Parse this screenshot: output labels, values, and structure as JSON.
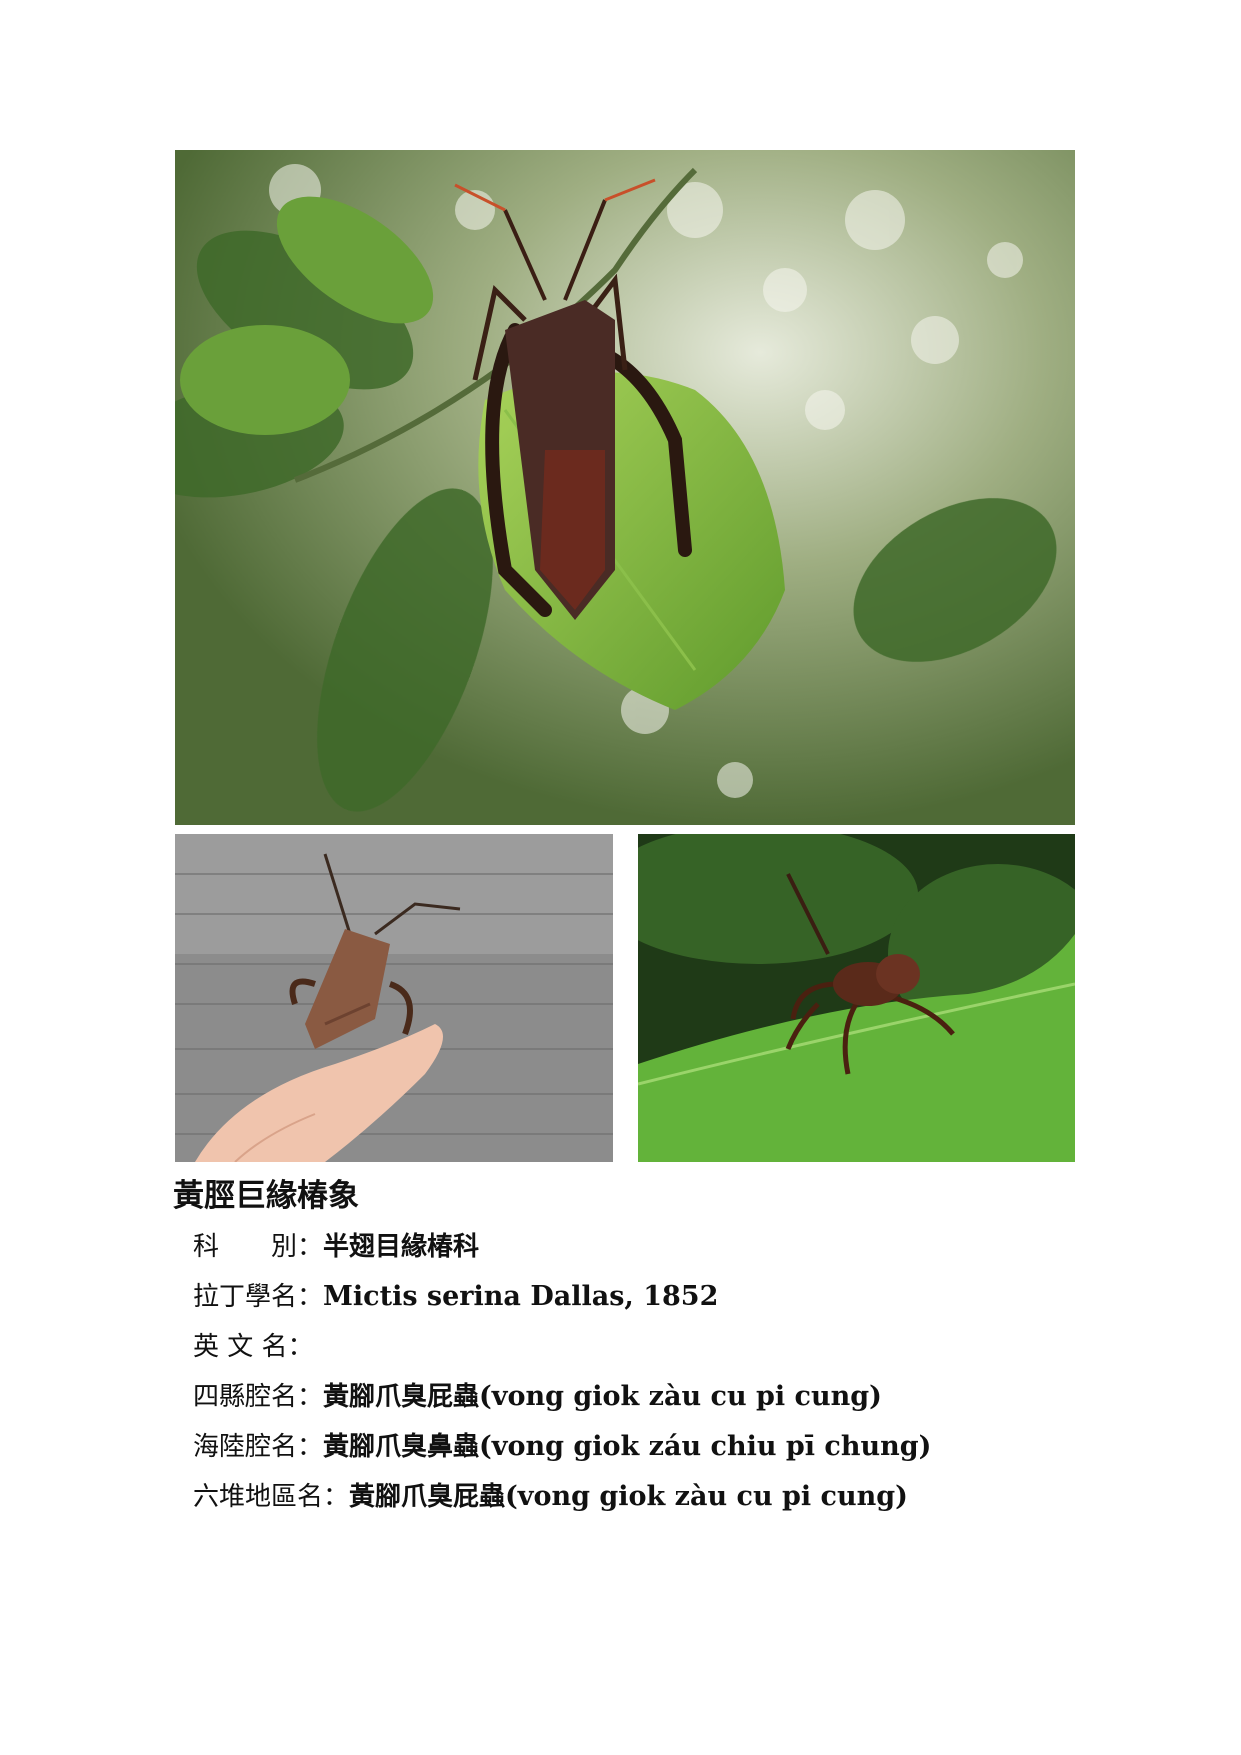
{
  "photos": {
    "main": {
      "description_icon": "leaf-bug-on-leaf-photo"
    },
    "hand": {
      "description_icon": "bug-on-finger-photo"
    },
    "nymph": {
      "description_icon": "nymph-on-leaf-photo"
    }
  },
  "title": "黃脛巨緣椿象",
  "fields": {
    "family": {
      "label": "科　　別：",
      "value": "半翅目緣椿科"
    },
    "latin": {
      "label": "拉丁學名：",
      "value": "Mictis serina Dallas, 1852"
    },
    "english": {
      "label": "英 文 名：",
      "value": ""
    },
    "sixian": {
      "label": "四縣腔名：",
      "value_cn": "黃腳爪臭屁蟲",
      "value_rom": "(vong giok zàu cu pi cung)"
    },
    "hailu": {
      "label": "海陸腔名：",
      "value_cn": "黃腳爪臭鼻蟲",
      "value_rom": "(vong giok záu chiu pī chung)"
    },
    "liudui": {
      "label": "六堆地區名：",
      "value_cn": "黃腳爪臭屁蟲",
      "value_rom": "(vong giok zàu cu pi cung)"
    }
  }
}
